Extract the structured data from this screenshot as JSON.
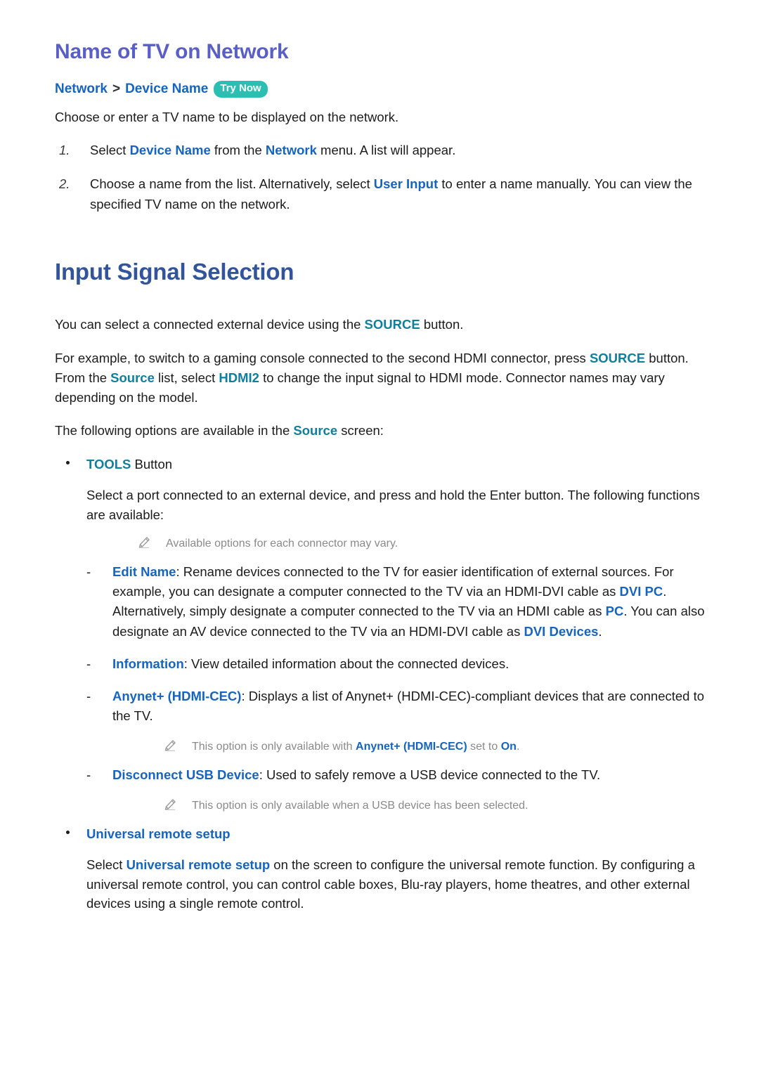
{
  "document": {
    "section1": {
      "heading": "Name of TV on Network",
      "breadcrumb": {
        "item1": "Network",
        "separator": ">",
        "item2": "Device Name",
        "badge": "Try Now"
      },
      "intro": "Choose or enter a TV name to be displayed on the network.",
      "steps": [
        {
          "number": "1.",
          "part1": "Select ",
          "kw1": "Device Name",
          "part2": " from the ",
          "kw2": "Network",
          "part3": " menu. A list will appear."
        },
        {
          "number": "2.",
          "part1": "Choose a name from the list. Alternatively, select ",
          "kw1": "User Input",
          "part2": " to enter a name manually. You can view the specified TV name on the network."
        }
      ]
    },
    "section2": {
      "heading": "Input Signal Selection",
      "para1": {
        "part1": "You can select a connected external device using the ",
        "kw1": "SOURCE",
        "part2": " button."
      },
      "para2": {
        "part1": "For example, to switch to a gaming console connected to the second HDMI connector, press ",
        "kw1": "SOURCE",
        "part2": " button. From the ",
        "kw2": "Source",
        "part3": " list, select ",
        "kw3": "HDMI2",
        "part4": " to change the input signal to HDMI mode. Connector names may vary depending on the model."
      },
      "para3": {
        "part1": "The following options are available in the ",
        "kw1": "Source",
        "part2": " screen:"
      },
      "bullet_tools": {
        "kw1": "TOOLS",
        "part1": " Button",
        "sub_para": "Select a port connected to an external device, and press and hold the Enter button. The following functions are available:",
        "note1": {
          "icon": "pencil-icon",
          "text": "Available options for each connector may vary."
        },
        "dashes": [
          {
            "mark": "-",
            "kw1": "Edit Name",
            "part1": ": Rename devices connected to the TV for easier identification of external sources. For example, you can designate a computer connected to the TV via an HDMI-DVI cable as ",
            "kw2": "DVI PC",
            "part2": ". Alternatively, simply designate a computer connected to the TV via an HDMI cable as ",
            "kw3": "PC",
            "part3": ". You can also designate an AV device connected to the TV via an HDMI-DVI cable as ",
            "kw4": "DVI Devices",
            "part4": "."
          },
          {
            "mark": "-",
            "kw1": "Information",
            "part1": ": View detailed information about the connected devices."
          },
          {
            "mark": "-",
            "kw1": "Anynet+ (HDMI-CEC)",
            "part1": ": Displays a list of Anynet+ (HDMI-CEC)-compliant devices that are connected to the TV."
          },
          {
            "mark": "-",
            "kw1": "Disconnect USB Device",
            "part1": ": Used to safely remove a USB device connected to the TV."
          }
        ],
        "note2": {
          "icon": "pencil-icon",
          "part1": "This option is only available with ",
          "kw1": "Anynet+ (HDMI-CEC)",
          "part2": " set to ",
          "kw2": "On",
          "part3": "."
        },
        "note3": {
          "icon": "pencil-icon",
          "text": "This option is only available when a USB device has been selected."
        }
      },
      "bullet_universal": {
        "label": "Universal remote setup",
        "sub_para": {
          "part1": "Select ",
          "kw1": "Universal remote setup",
          "part2": " on the screen to configure the universal remote function. By configuring a universal remote control, you can control cable boxes, Blu-ray players, home theatres, and other external devices using a single remote control."
        }
      }
    }
  },
  "colors": {
    "heading_purple": "#5a5fc7",
    "heading_navy": "#32549b",
    "keyword_teal": "#0e7f9e",
    "keyword_blue": "#1565c0",
    "badge_teal": "#2bbfb4",
    "note_gray": "#8a8a8a"
  }
}
